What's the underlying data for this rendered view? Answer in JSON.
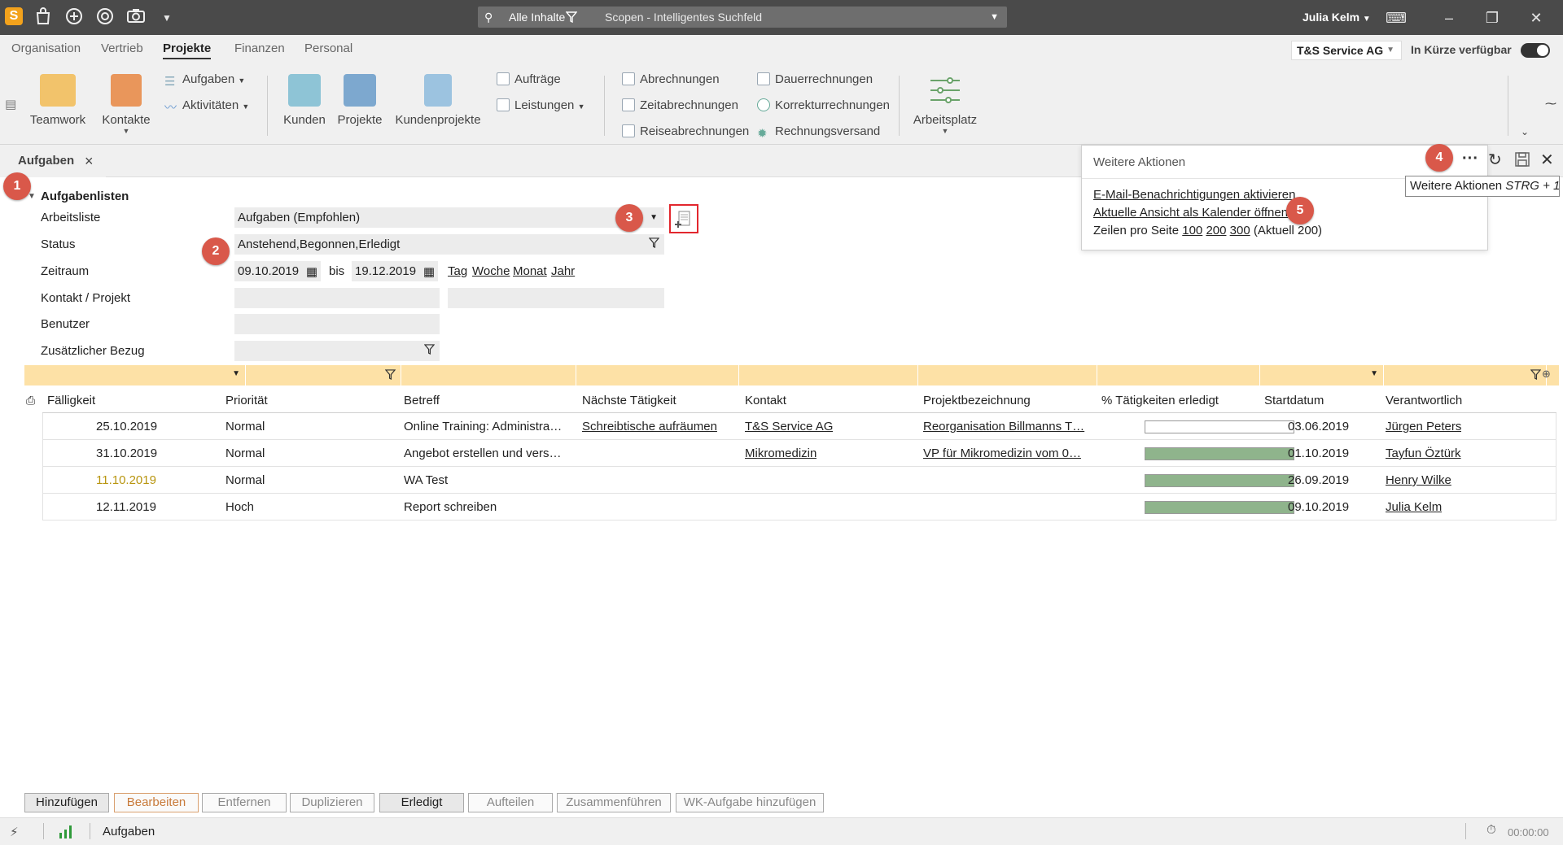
{
  "titlebar": {
    "search_scope": "Alle Inhalte",
    "search_placeholder": "Scopen - Intelligentes Suchfeld",
    "user": "Julia Kelm",
    "icons": [
      "app-logo-icon",
      "bag-icon",
      "plus-circle-icon",
      "lifebuoy-icon",
      "camera-icon",
      "chevron-down-icon"
    ]
  },
  "menu": {
    "items": [
      "Organisation",
      "Vertrieb",
      "Projekte",
      "Finanzen",
      "Personal"
    ],
    "active": "Projekte",
    "company": "T&S Service AG",
    "soon": "In Kürze verfügbar"
  },
  "ribbon": {
    "teamwork": "Teamwork",
    "kontakte": "Kontakte",
    "aufgaben": "Aufgaben",
    "aktivitaeten": "Aktivitäten",
    "kunden": "Kunden",
    "projekte": "Projekte",
    "kundenprojekte": "Kundenprojekte",
    "auftraege": "Aufträge",
    "leistungen": "Leistungen",
    "abrechnungen": "Abrechnungen",
    "zeitabrechnungen": "Zeitabrechnungen",
    "reiseabrechnungen": "Reiseabrechnungen",
    "dauerrechnungen": "Dauerrechnungen",
    "korrekturrechnungen": "Korrekturrechnungen",
    "rechnungsversand": "Rechnungsversand",
    "arbeitsplatz": "Arbeitsplatz"
  },
  "tab": {
    "label": "Aufgaben"
  },
  "badges": [
    "1",
    "2",
    "3",
    "4",
    "5"
  ],
  "form": {
    "section_title": "Aufgabenlisten",
    "arbeitsliste_label": "Arbeitsliste",
    "arbeitsliste_value": "Aufgaben (Empfohlen)",
    "status_label": "Status",
    "status_value": "Anstehend,Begonnen,Erledigt",
    "zeitraum_label": "Zeitraum",
    "date_from": "09.10.2019",
    "bis": "bis",
    "date_to": "19.12.2019",
    "range_links": [
      "Tag",
      "Woche",
      "Monat",
      "Jahr"
    ],
    "kontakt_label": "Kontakt / Projekt",
    "benutzer_label": "Benutzer",
    "bezug_label": "Zusätzlicher Bezug"
  },
  "grid": {
    "columns": [
      "Fälligkeit",
      "Priorität",
      "Betreff",
      "Nächste Tätigkeit",
      "Kontakt",
      "Projektbezeichnung",
      "% Tätigkeiten erledigt",
      "Startdatum",
      "Verantwortlich"
    ],
    "rows": [
      {
        "faellig": "25.10.2019",
        "prio": "Normal",
        "betreff": "Online Training: Administra…",
        "naechste": "Schreibtische aufräumen",
        "kontakt": "T&S Service AG",
        "projekt": "Reorganisation Billmanns T…",
        "pct": 0,
        "start": "03.06.2019",
        "verantw": "Jürgen Peters",
        "overdue": false
      },
      {
        "faellig": "31.10.2019",
        "prio": "Normal",
        "betreff": "Angebot erstellen und vers…",
        "naechste": "",
        "kontakt": "Mikromedizin",
        "projekt": "VP für Mikromedizin vom 0…",
        "pct": 100,
        "start": "01.10.2019",
        "verantw": "Tayfun Öztürk",
        "overdue": false
      },
      {
        "faellig": "11.10.2019",
        "prio": "Normal",
        "betreff": "WA Test",
        "naechste": "",
        "kontakt": "",
        "projekt": "",
        "pct": 100,
        "start": "26.09.2019",
        "verantw": "Henry Wilke",
        "overdue": true
      },
      {
        "faellig": "12.11.2019",
        "prio": "Hoch",
        "betreff": "Report schreiben",
        "naechste": "",
        "kontakt": "",
        "projekt": "",
        "pct": 100,
        "start": "09.10.2019",
        "verantw": "Julia Kelm",
        "overdue": false
      }
    ]
  },
  "popup": {
    "title": "Weitere Aktionen",
    "link1": "E-Mail-Benachrichtigungen aktivieren",
    "link2": "Aktuelle Ansicht als Kalender öffnen",
    "rows_prefix": "Zeilen pro Seite",
    "rows_options": [
      "100",
      "200",
      "300"
    ],
    "rows_current": "(Aktuell 200)",
    "tooltip_label": "Weitere Aktionen",
    "tooltip_shortcut": "STRG + 1"
  },
  "buttons": [
    "Hinzufügen",
    "Bearbeiten",
    "Entfernen",
    "Duplizieren",
    "Erledigt",
    "Aufteilen",
    "Zusammenführen",
    "WK-Aufgabe hinzufügen"
  ],
  "statusbar": {
    "label": "Aufgaben",
    "time": "00:00:00"
  },
  "colors": {
    "accent": "#d9584a",
    "filter_row": "#fde1a6",
    "progress": "#8fb48c",
    "overdue": "#b8950f"
  }
}
